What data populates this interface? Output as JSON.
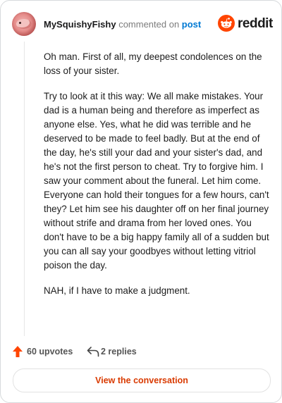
{
  "header": {
    "username": "MySquishyFishy",
    "commented_on": " commented on ",
    "post_link": "post",
    "brand": "reddit"
  },
  "comment": {
    "paragraphs": [
      "Oh man. First of all, my deepest condolences on the loss of your sister.",
      "Try to look at it this way: We all make mistakes. Your dad is a human being and therefore as imperfect as anyone else. Yes, what he did was terrible and he deserved to be made to feel badly. But at the end of the day, he's still your dad and your sister's dad, and he's not the first person to cheat. Try to forgive him. I saw your comment about the funeral. Let him come. Everyone can hold their tongues for a few hours, can't they? Let him see his daughter off on her final journey without strife and drama from her loved ones. You don't have to be a big happy family all of a sudden but you can all say your goodbyes without letting vitriol poison the day.",
      "NAH, if I have to make a judgment."
    ]
  },
  "footer": {
    "upvotes": "60 upvotes",
    "replies": "2 replies",
    "view_button": "View the conversation"
  },
  "icons": {
    "upvote": "arrow-up-icon",
    "reply": "reply-arrow-icon",
    "brand": "reddit-snoo-icon"
  },
  "colors": {
    "accent": "#ff4500",
    "link": "#0079d3",
    "button_text": "#d93a00"
  }
}
